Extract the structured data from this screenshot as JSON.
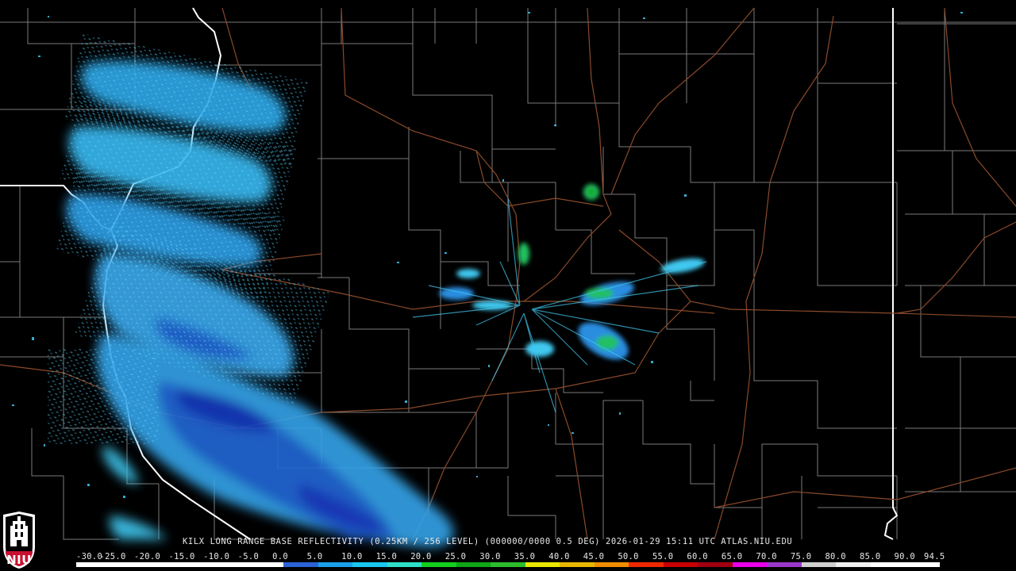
{
  "caption": "KILX LONG RANGE BASE REFLECTIVITY (0.25KM / 256 LEVEL) (000000/0000 0.5 DEG) 2026-01-29 15:11 UTC  ATLAS.NIU.EDU",
  "logo": {
    "text": "NIU",
    "icon": "niu-tower-seal"
  },
  "scale": {
    "labels": [
      "-30.0",
      "-25.0",
      "-20.0",
      "-15.0",
      "-10.0",
      "-5.0",
      "0.0",
      "5.0",
      "10.0",
      "15.0",
      "20.0",
      "25.0",
      "30.0",
      "35.0",
      "40.0",
      "45.0",
      "50.0",
      "55.0",
      "60.0",
      "65.0",
      "70.0",
      "75.0",
      "80.0",
      "85.0",
      "90.0",
      "94.5"
    ],
    "colors": [
      "#ffffff",
      "#ffffff",
      "#ffffff",
      "#ffffff",
      "#ffffff",
      "#ffffff",
      "#2a63d6",
      "#1aa0e8",
      "#18c8f0",
      "#2fe0c8",
      "#12d01e",
      "#0fa617",
      "#2cbc2c",
      "#e8e800",
      "#e8b800",
      "#f08c00",
      "#f02800",
      "#c80000",
      "#a00010",
      "#e800e8",
      "#9a38cc",
      "#d0d0d0",
      "#f0f0f0",
      "#ffffff",
      "#ffffff"
    ]
  },
  "colors": {
    "background": "#000000",
    "county_line": "#7a7a7a",
    "state_line": "#ffffff",
    "highway": "#8b4a2a",
    "echo_light": "#40c8f0",
    "echo_mid": "#2a8de0",
    "echo_heavy": "#1a3ec8",
    "echo_green": "#22c060"
  }
}
